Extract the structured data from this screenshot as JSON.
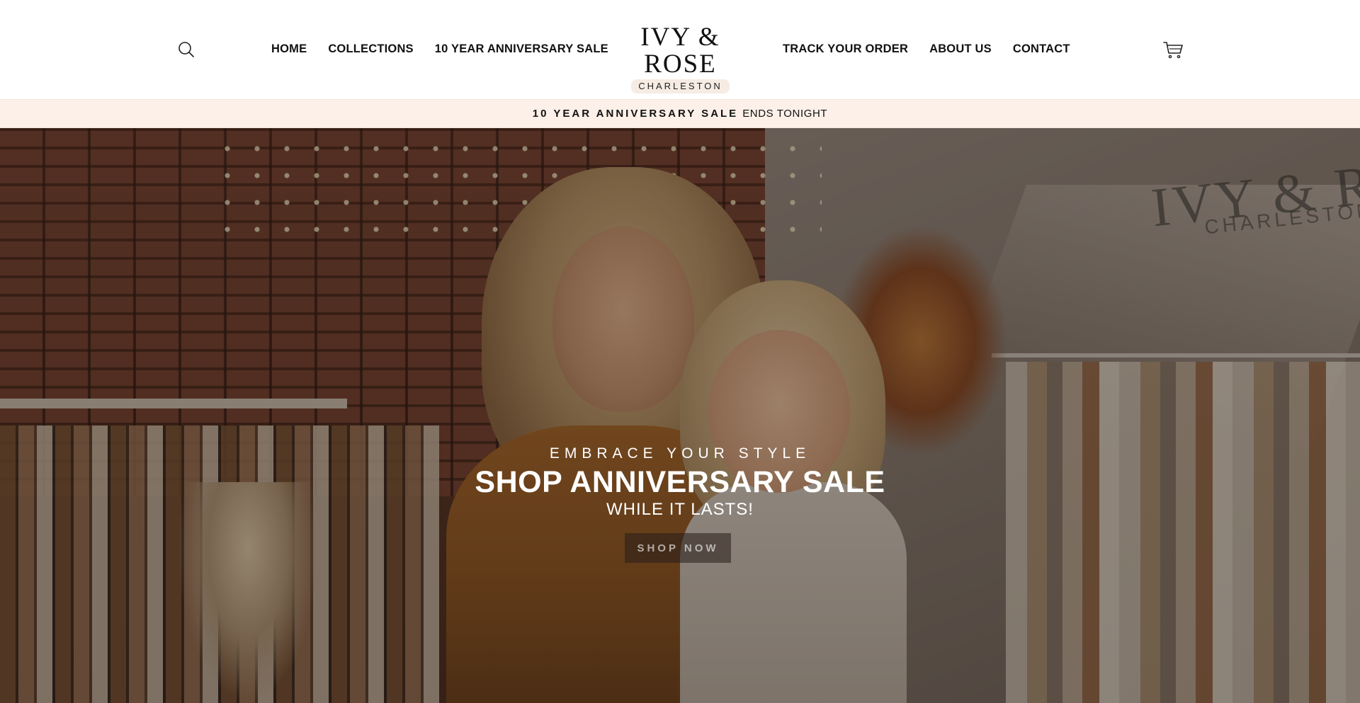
{
  "header": {
    "search_icon": "search-icon",
    "nav_left": [
      {
        "label": "HOME"
      },
      {
        "label": "COLLECTIONS"
      },
      {
        "label": "10 YEAR ANNIVERSARY SALE"
      }
    ],
    "logo": {
      "title": "IVY & ROSE",
      "subtitle": "CHARLESTON"
    },
    "nav_right": [
      {
        "label": "TRACK YOUR ORDER"
      },
      {
        "label": "ABOUT US"
      },
      {
        "label": "CONTACT"
      }
    ],
    "cart_icon": "cart-icon"
  },
  "announcement": {
    "bold_text": "10 YEAR ANNIVERSARY SALE",
    "text": "ENDS TONIGHT",
    "background": "#fcf0e8"
  },
  "hero": {
    "eyebrow": "EMBRACE YOUR STYLE",
    "title": "SHOP ANNIVERSARY SALE",
    "subtitle": "WHILE IT LASTS!",
    "cta_label": "SHOP NOW",
    "wall_logo_title": "IVY & RO",
    "wall_logo_subtitle": "CHARLESTON"
  }
}
